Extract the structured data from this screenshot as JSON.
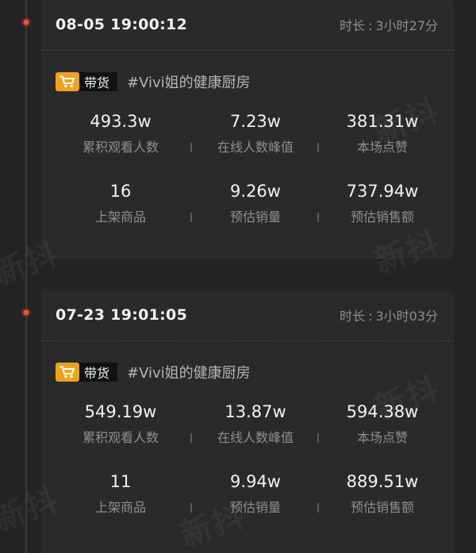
{
  "sessions": [
    {
      "start_time": "08-05 19:00:12",
      "duration_label": "时长",
      "duration_value": "3小时27分",
      "tag_label": "带货",
      "tag_icon": "shopping-cart-icon",
      "topic": "#Vivi姐的健康厨房",
      "stats": [
        {
          "value": "493.3w",
          "label": "累积观看人数"
        },
        {
          "value": "7.23w",
          "label": "在线人数峰值"
        },
        {
          "value": "381.31w",
          "label": "本场点赞"
        },
        {
          "value": "16",
          "label": "上架商品"
        },
        {
          "value": "9.26w",
          "label": "预估销量"
        },
        {
          "value": "737.94w",
          "label": "预估销售额"
        }
      ]
    },
    {
      "start_time": "07-23 19:01:05",
      "duration_label": "时长",
      "duration_value": "3小时03分",
      "tag_label": "带货",
      "tag_icon": "shopping-cart-icon",
      "topic": "#Vivi姐的健康厨房",
      "stats": [
        {
          "value": "549.19w",
          "label": "累积观看人数"
        },
        {
          "value": "13.87w",
          "label": "在线人数峰值"
        },
        {
          "value": "594.38w",
          "label": "本场点赞"
        },
        {
          "value": "11",
          "label": "上架商品"
        },
        {
          "value": "9.94w",
          "label": "预估销量"
        },
        {
          "value": "889.51w",
          "label": "预估销售额"
        }
      ]
    }
  ],
  "watermark_text": "新抖",
  "colors": {
    "background": "#232325",
    "card": "#2a2a2c",
    "timeline_dot": "#e2583a",
    "tag_icon_bg": "#f0a21e"
  }
}
